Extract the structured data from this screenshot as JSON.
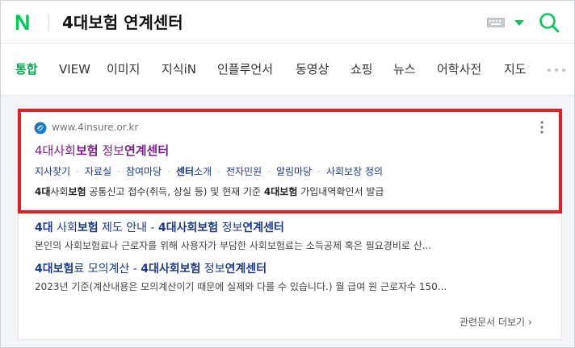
{
  "header": {
    "logo": "N",
    "query": "4대보험 연계센터"
  },
  "tabs": [
    {
      "label": "통합",
      "active": true
    },
    {
      "label": "VIEW"
    },
    {
      "label": "이미지"
    },
    {
      "label": "지식iN"
    },
    {
      "label": "인플루언서"
    },
    {
      "label": "동영상"
    },
    {
      "label": "쇼핑"
    },
    {
      "label": "뉴스"
    },
    {
      "label": "어학사전"
    },
    {
      "label": "지도"
    }
  ],
  "result": {
    "url": "www.4insure.or.kr",
    "title_pre": "4대사회",
    "title_bold1": "보험",
    "title_mid": " 정보",
    "title_bold2": "연계센터",
    "sitelinks": [
      "지사찾기",
      "자료실",
      "참여마당",
      "센터",
      "소개",
      "전자민원",
      "알림마당",
      "사회보장 정의"
    ],
    "snippet_b1": "4대",
    "snippet_t1": "사회",
    "snippet_b2": "보험",
    "snippet_t2": " 공통신고 접수(취득, 상실 등) 및 현재 기준 ",
    "snippet_b3": "4대보험",
    "snippet_t3": " 가입내역확인서 발급"
  },
  "sub_results": [
    {
      "title_b1": "4대",
      "title_t1": " 사회",
      "title_b2": "보험",
      "title_t2": " 제도 안내 - ",
      "title_b3": "4대사회보험",
      "title_t3": " 정보",
      "title_b4": "연계센터",
      "desc": "본인의 사회보험료나 근로자를 위해 사용자가 부담한 사회보험료는 소득공제 혹은 필요경비로 산..."
    },
    {
      "title_b1": "4대보험",
      "title_t1": "료 모의계산 - ",
      "title_b2": "4대사회보험",
      "title_t2": " 정보",
      "title_b3": "연계센터",
      "desc": "2023년 기준(계산내용은 모의계산이기 때문에 실제와 다를 수 있습니다.) 월 급여 원 근로자수 150..."
    }
  ],
  "more_docs": "관련문서 더보기",
  "colors": {
    "brand": "#03c75a",
    "highlight": "#e31f26",
    "visited_link": "#7b1e8a",
    "link": "#1b3a8a"
  }
}
